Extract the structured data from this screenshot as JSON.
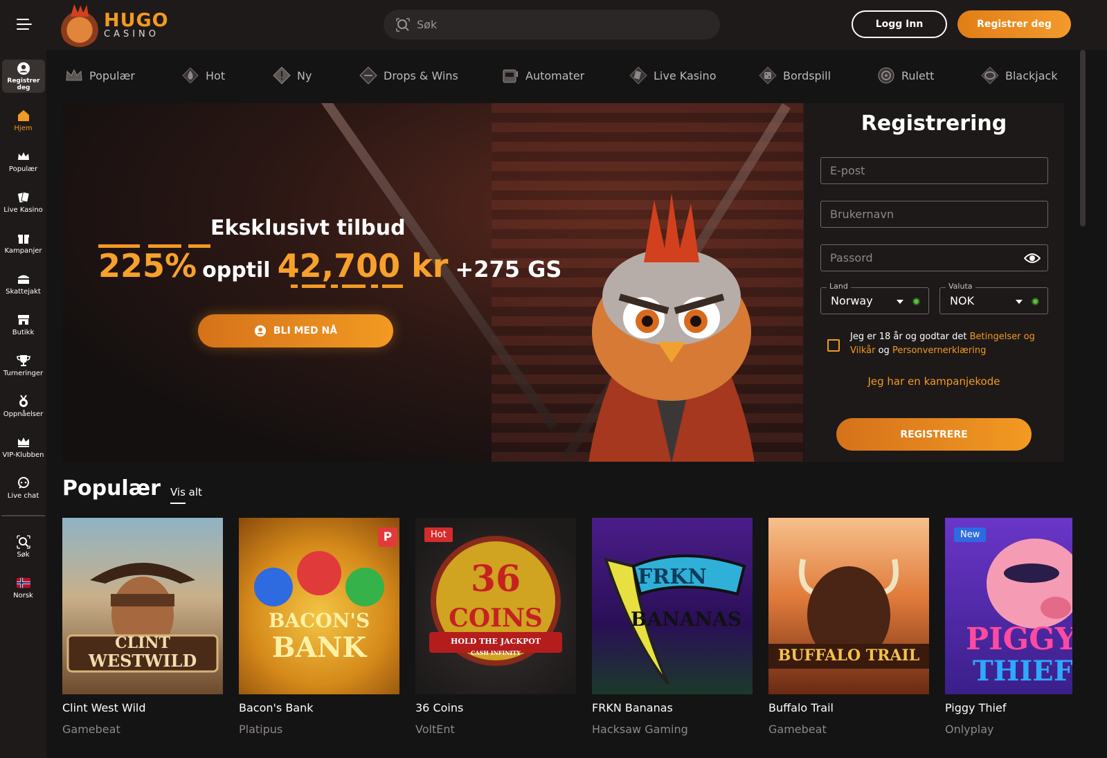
{
  "header": {
    "logo_title": "HUGO",
    "logo_subtitle": "CASINO",
    "search_placeholder": "Søk",
    "login_label": "Logg Inn",
    "register_label": "Registrer deg",
    "accent_color": "#f29a22"
  },
  "sidebar": {
    "register": "Registrer deg",
    "items": [
      {
        "label": "Hjem",
        "icon": "home-icon"
      },
      {
        "label": "Populær",
        "icon": "crown-icon"
      },
      {
        "label": "Live Kasino",
        "icon": "cards-icon"
      },
      {
        "label": "Kampanjer",
        "icon": "gift-icon"
      },
      {
        "label": "Skattejakt",
        "icon": "treasure-chest-icon"
      },
      {
        "label": "Butikk",
        "icon": "shop-icon"
      },
      {
        "label": "Turneringer",
        "icon": "trophy-icon"
      },
      {
        "label": "Oppnåelser",
        "icon": "medal-icon"
      },
      {
        "label": "VIP-Klubben",
        "icon": "vip-crown-icon"
      },
      {
        "label": "Live chat",
        "icon": "chat-icon"
      },
      {
        "label": "Søk",
        "icon": "search-icon"
      },
      {
        "label": "Norsk",
        "icon": "norway-flag-icon"
      }
    ]
  },
  "categories": [
    {
      "label": "Populær",
      "icon": "crown-icon"
    },
    {
      "label": "Hot",
      "icon": "flame-icon"
    },
    {
      "label": "Ny",
      "icon": "new-badge-icon"
    },
    {
      "label": "Drops & Wins",
      "icon": "drops-wins-icon"
    },
    {
      "label": "Automater",
      "icon": "slot-machine-icon"
    },
    {
      "label": "Live Kasino",
      "icon": "live-cards-icon"
    },
    {
      "label": "Bordspill",
      "icon": "dice-icon"
    },
    {
      "label": "Rulett",
      "icon": "roulette-icon"
    },
    {
      "label": "Blackjack",
      "icon": "blackjack-icon"
    }
  ],
  "hero": {
    "title": "Eksklusivt tilbud",
    "percent": "225%",
    "upto": "opptil",
    "amount": "42,700 kr",
    "spins": "+275 GS",
    "cta": "BLI MED NÅ"
  },
  "registration": {
    "title": "Registrering",
    "email_placeholder": "E-post",
    "username_placeholder": "Brukernavn",
    "password_placeholder": "Passord",
    "country_label": "Land",
    "country_value": "Norway",
    "currency_label": "Valuta",
    "currency_value": "NOK",
    "terms_prefix": "Jeg er 18 år og godtar det",
    "terms_link": "Betingelser og Vilkår",
    "terms_and": "og",
    "privacy_link": "Personvernerklæring",
    "promo_link": "Jeg har en kampanjekode",
    "submit": "REGISTRERE"
  },
  "popular": {
    "title": "Populær",
    "view_all": "Vis alt",
    "games": [
      {
        "name": "Clint West Wild",
        "provider": "Gamebeat",
        "logo_line1": "CLINT",
        "logo_line2": "WESTWILD"
      },
      {
        "name": "Bacon's Bank",
        "provider": "Platipus",
        "logo_line1": "BACON'S",
        "logo_line2": "BANK",
        "corner": "P"
      },
      {
        "name": "36 Coins",
        "provider": "VoltEnt",
        "badge": "Hot",
        "logo_line1": "36",
        "logo_line2": "COINS",
        "logo_line3": "HOLD THE JACKPOT",
        "logo_line4": "CASH INFINITY"
      },
      {
        "name": "FRKN Bananas",
        "provider": "Hacksaw Gaming",
        "logo_line1": "FRKN",
        "logo_line2": "BANANAS"
      },
      {
        "name": "Buffalo Trail",
        "provider": "Gamebeat",
        "logo_line1": "BUFFALO TRAIL"
      },
      {
        "name": "Piggy Thief",
        "provider": "Onlyplay",
        "badge": "New",
        "logo_line1": "PIGGY",
        "logo_line2": "THIEF"
      }
    ]
  }
}
